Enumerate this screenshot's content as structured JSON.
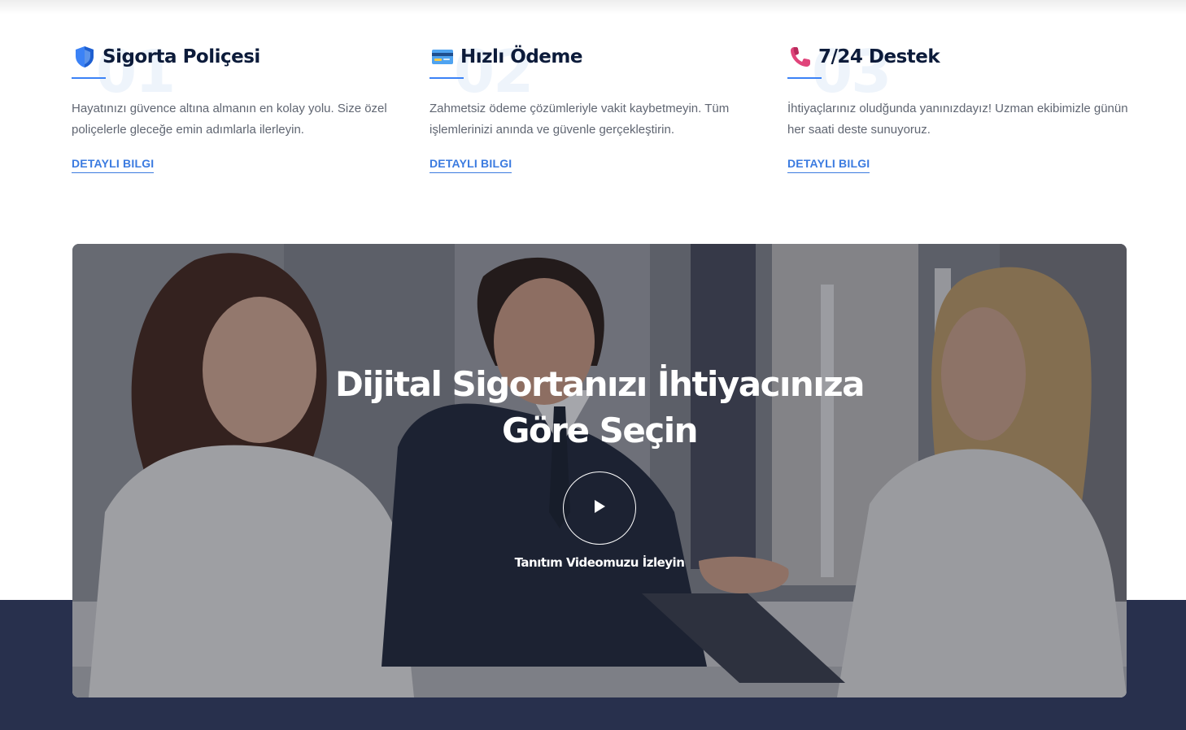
{
  "features": [
    {
      "number": "01",
      "icon": "shield-icon",
      "title": "Sigorta Poliçesi",
      "description": "Hayatınızı güvence altına almanın en kolay yolu. Size özel poliçelerle gleceğe emin adımlarla ilerleyin.",
      "link": "DETAYLI BILGI"
    },
    {
      "number": "02",
      "icon": "credit-card-icon",
      "title": "Hızlı Ödeme",
      "description": "Zahmetsiz ödeme çözümleriyle vakit kaybetmeyin. Tüm işlemlerinizi anında ve güvenle gerçekleştirin.",
      "link": "DETAYLI BILGI"
    },
    {
      "number": "03",
      "icon": "phone-icon",
      "title": "7/24 Destek",
      "description": "İhtiyaçlarınız oludğunda yanınızdayız! Uzman ekibimizle günün her saati deste sunuyoruz.",
      "link": "DETAYLI BILGI"
    }
  ],
  "hero": {
    "headline_line1": "Dijital Sigortanızı İhtiyacınıza",
    "headline_line2": "Göre Seçin",
    "play_icon": "play-icon",
    "video_caption": "Tanıtım Videomuzu İzleyin"
  },
  "colors": {
    "accent": "#3b7be0",
    "heading": "#0c1b3a",
    "body_text": "#606672",
    "navy_band": "#28304d",
    "shield": "#3b82f6",
    "phone": "#e0447a"
  }
}
